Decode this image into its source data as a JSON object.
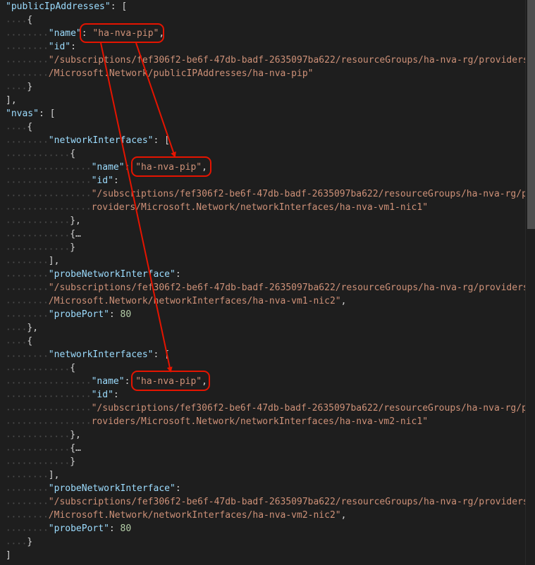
{
  "editor": {
    "lines": [
      [
        {
          "t": "\"publicIpAddresses\"",
          "c": "key"
        },
        {
          "t": ": [",
          "c": "punc"
        }
      ],
      [
        {
          "t": "{",
          "c": "punc"
        }
      ],
      [
        {
          "t": "\"name\"",
          "c": "key"
        },
        {
          "t": ": ",
          "c": "punc"
        },
        {
          "t": "\"ha-nva-pip\"",
          "c": "str"
        },
        {
          "t": ",",
          "c": "punc"
        }
      ],
      [
        {
          "t": "\"id\"",
          "c": "key"
        },
        {
          "t": ":",
          "c": "punc"
        }
      ],
      [
        {
          "t": "\"/subscriptions/fef306f2-be6f-47db-badf-2635097ba622/resourceGroups/ha-nva-rg/providers",
          "c": "str"
        }
      ],
      [
        {
          "t": "/Microsoft.Network/publicIPAddresses/ha-nva-pip\"",
          "c": "str"
        }
      ],
      [
        {
          "t": "}",
          "c": "punc"
        }
      ],
      [
        {
          "t": "],",
          "c": "punc"
        }
      ],
      [
        {
          "t": "\"nvas\"",
          "c": "key"
        },
        {
          "t": ": [",
          "c": "punc"
        }
      ],
      [
        {
          "t": "{",
          "c": "punc"
        }
      ],
      [
        {
          "t": "\"networkInterfaces\"",
          "c": "key"
        },
        {
          "t": ": [",
          "c": "punc"
        }
      ],
      [
        {
          "t": "{",
          "c": "punc"
        }
      ],
      [
        {
          "t": "\"name\"",
          "c": "key"
        },
        {
          "t": ": ",
          "c": "punc"
        },
        {
          "t": "\"ha-nva-pip\"",
          "c": "str"
        },
        {
          "t": ",",
          "c": "punc"
        }
      ],
      [
        {
          "t": "\"id\"",
          "c": "key"
        },
        {
          "t": ":",
          "c": "punc"
        }
      ],
      [
        {
          "t": "\"/subscriptions/fef306f2-be6f-47db-badf-2635097ba622/resourceGroups/ha-nva-rg/p",
          "c": "str"
        }
      ],
      [
        {
          "t": "roviders/Microsoft.Network/networkInterfaces/ha-nva-vm1-nic1\"",
          "c": "str"
        }
      ],
      [
        {
          "t": "},",
          "c": "punc"
        }
      ],
      [
        {
          "t": "{…",
          "c": "fold"
        }
      ],
      [
        {
          "t": "}",
          "c": "punc"
        }
      ],
      [
        {
          "t": "],",
          "c": "punc"
        }
      ],
      [
        {
          "t": "\"probeNetworkInterface\"",
          "c": "key"
        },
        {
          "t": ":",
          "c": "punc"
        }
      ],
      [
        {
          "t": "\"/subscriptions/fef306f2-be6f-47db-badf-2635097ba622/resourceGroups/ha-nva-rg/providers",
          "c": "str"
        }
      ],
      [
        {
          "t": "/Microsoft.Network/networkInterfaces/ha-nva-vm1-nic2\"",
          "c": "str"
        },
        {
          "t": ",",
          "c": "punc"
        }
      ],
      [
        {
          "t": "\"probePort\"",
          "c": "key"
        },
        {
          "t": ": ",
          "c": "punc"
        },
        {
          "t": "80",
          "c": "num"
        }
      ],
      [
        {
          "t": "},",
          "c": "punc"
        }
      ],
      [
        {
          "t": "{",
          "c": "punc"
        }
      ],
      [
        {
          "t": "\"networkInterfaces\"",
          "c": "key"
        },
        {
          "t": ": [",
          "c": "punc"
        }
      ],
      [
        {
          "t": "{",
          "c": "punc"
        }
      ],
      [
        {
          "t": "\"name\"",
          "c": "key"
        },
        {
          "t": ": ",
          "c": "punc"
        },
        {
          "t": "\"ha-nva-pip\"",
          "c": "str"
        },
        {
          "t": ",",
          "c": "punc"
        }
      ],
      [
        {
          "t": "\"id\"",
          "c": "key"
        },
        {
          "t": ":",
          "c": "punc"
        }
      ],
      [
        {
          "t": "\"/subscriptions/fef306f2-be6f-47db-badf-2635097ba622/resourceGroups/ha-nva-rg/p",
          "c": "str"
        }
      ],
      [
        {
          "t": "roviders/Microsoft.Network/networkInterfaces/ha-nva-vm2-nic1\"",
          "c": "str"
        }
      ],
      [
        {
          "t": "},",
          "c": "punc"
        }
      ],
      [
        {
          "t": "{…",
          "c": "fold"
        }
      ],
      [
        {
          "t": "}",
          "c": "punc"
        }
      ],
      [
        {
          "t": "],",
          "c": "punc"
        }
      ],
      [
        {
          "t": "\"probeNetworkInterface\"",
          "c": "key"
        },
        {
          "t": ":",
          "c": "punc"
        }
      ],
      [
        {
          "t": "\"/subscriptions/fef306f2-be6f-47db-badf-2635097ba622/resourceGroups/ha-nva-rg/providers",
          "c": "str"
        }
      ],
      [
        {
          "t": "/Microsoft.Network/networkInterfaces/ha-nva-vm2-nic2\"",
          "c": "str"
        },
        {
          "t": ",",
          "c": "punc"
        }
      ],
      [
        {
          "t": "\"probePort\"",
          "c": "key"
        },
        {
          "t": ": ",
          "c": "punc"
        },
        {
          "t": "80",
          "c": "num"
        }
      ],
      [
        {
          "t": "}",
          "c": "punc"
        }
      ],
      [
        {
          "t": "]",
          "c": "punc"
        }
      ]
    ]
  },
  "colors": {
    "background": "#1e1e1e",
    "key": "#9cdcfe",
    "string": "#ce9178",
    "number": "#b5cea8",
    "punctuation": "#d4d4d4",
    "annotation": "#e51400"
  }
}
